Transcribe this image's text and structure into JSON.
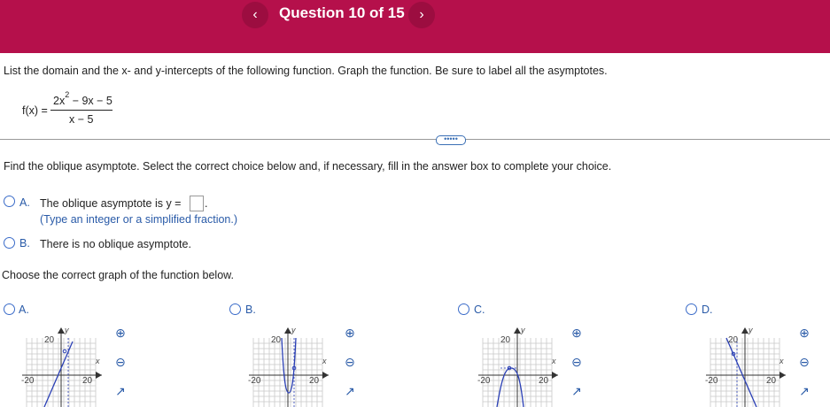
{
  "header": {
    "title": "Question 10 of 15",
    "prev_icon": "chevron-left-icon",
    "next_icon": "chevron-right-icon",
    "prev_glyph": "‹",
    "next_glyph": "›",
    "bg_color": "#b5104b"
  },
  "question": {
    "prompt": "List the domain and the x- and y-intercepts of the following function. Graph the function. Be sure to label all the asymptotes.",
    "fx_label": "f(x) =",
    "numerator_a": "2x",
    "numerator_exp": "2",
    "numerator_b": " − 9x − 5",
    "denominator": "x − 5"
  },
  "expander": {
    "label": "•••••"
  },
  "part": {
    "instruction": "Find the oblique asymptote. Select the correct choice below and, if necessary, fill in the answer box to complete your choice.",
    "options": [
      {
        "letter": "A.",
        "text": "The oblique asymptote is y =",
        "hint": "(Type an integer or a simplified fraction.)"
      },
      {
        "letter": "B.",
        "text": "There is no oblique asymptote."
      }
    ],
    "answer_value": ""
  },
  "graph_section": {
    "instruction": "Choose the correct graph of the function below.",
    "options": [
      {
        "letter": "A.",
        "tick_y": "20",
        "tick_xneg": "-20",
        "tick_xpos": "20",
        "axis_y": "y",
        "axis_x": "x"
      },
      {
        "letter": "B.",
        "tick_y": "20",
        "tick_xneg": "-20",
        "tick_xpos": "20",
        "axis_y": "y",
        "axis_x": "x"
      },
      {
        "letter": "C.",
        "tick_y": "20",
        "tick_xneg": "-20",
        "tick_xpos": "20",
        "axis_y": "y",
        "axis_x": "x"
      },
      {
        "letter": "D.",
        "tick_y": "20",
        "tick_xneg": "-20",
        "tick_xpos": "20",
        "axis_y": "y",
        "axis_x": "x"
      }
    ],
    "tools": [
      "zoom-in-icon",
      "zoom-out-icon",
      "expand-icon"
    ]
  }
}
